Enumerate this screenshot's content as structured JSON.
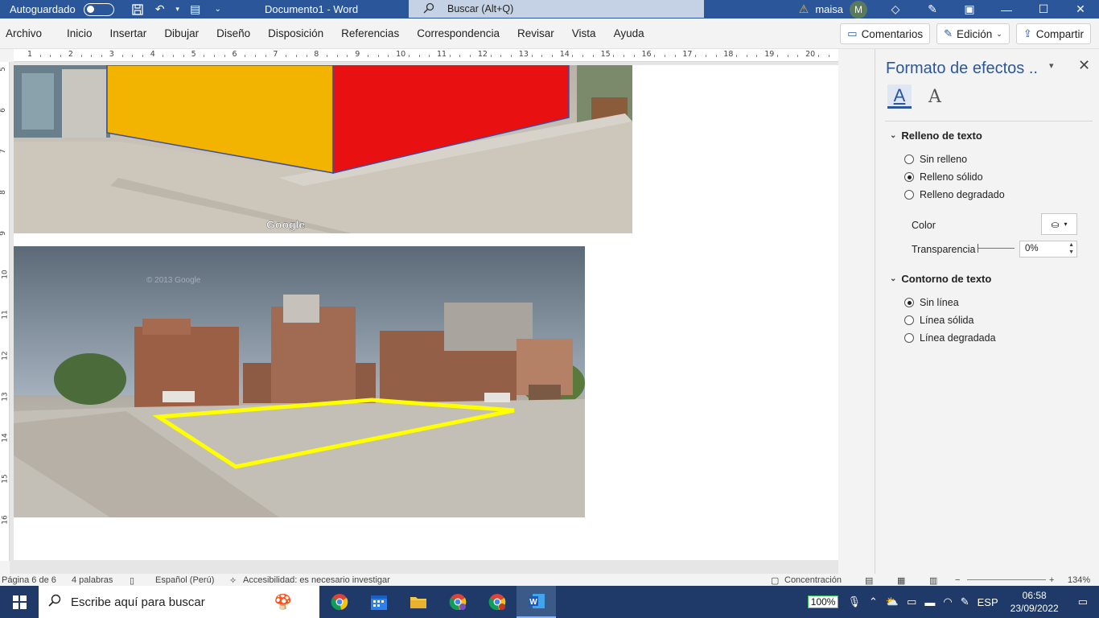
{
  "titlebar": {
    "autosave_label": "Autoguardado",
    "doc_title": "Documento1  -  Word",
    "search_placeholder": "Buscar (Alt+Q)",
    "user_name": "maisa",
    "user_initial": "M"
  },
  "ribbon": {
    "tabs": [
      "Archivo",
      "Inicio",
      "Insertar",
      "Dibujar",
      "Diseño",
      "Disposición",
      "Referencias",
      "Correspondencia",
      "Revisar",
      "Vista",
      "Ayuda"
    ],
    "comments_label": "Comentarios",
    "editing_label": "Edición",
    "share_label": "Compartir"
  },
  "ruler": {
    "marks": [
      "1",
      "2",
      "3",
      "4",
      "5",
      "6",
      "7",
      "8",
      "9",
      "10",
      "11",
      "12",
      "13",
      "14",
      "15",
      "16",
      "17",
      "18",
      "19",
      "20"
    ],
    "vmarks": [
      "5",
      "6",
      "7",
      "8",
      "9",
      "10",
      "11",
      "12",
      "13",
      "14",
      "15",
      "16"
    ]
  },
  "document": {
    "image1_watermark": "Google",
    "image2_watermark": "© 2013 Google"
  },
  "pane": {
    "title": "Formato de efectos ..",
    "section_fill": "Relleno de texto",
    "fill_options": [
      "Sin relleno",
      "Relleno sólido",
      "Relleno degradado"
    ],
    "fill_selected_index": 1,
    "color_label": "Color",
    "transparency_label": "Transparencia",
    "transparency_value": "0%",
    "section_outline": "Contorno de texto",
    "outline_options": [
      "Sin línea",
      "Línea sólida",
      "Línea degradada"
    ],
    "outline_selected_index": 0
  },
  "status": {
    "page": "Página 6 de 6",
    "words": "4 palabras",
    "language": "Español (Perú)",
    "accessibility": "Accesibilidad: es necesario investigar",
    "focus": "Concentración",
    "zoom": "134%"
  },
  "taskbar": {
    "search_placeholder": "Escribe aquí para buscar",
    "battery_badge": "100%",
    "lang": "ESP",
    "time": "06:58",
    "date": "23/09/2022"
  },
  "colors": {
    "word_blue": "#2b579a",
    "overlay_yellow": "#f2c200",
    "overlay_red": "#e81010",
    "outline_yellow": "#ffff00"
  }
}
